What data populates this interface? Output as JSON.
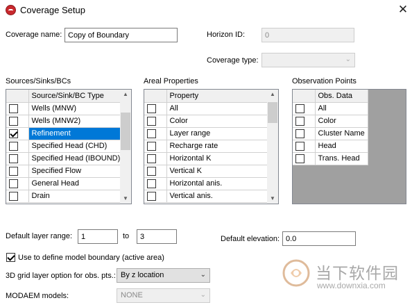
{
  "window": {
    "title": "Coverage Setup",
    "close": "✕"
  },
  "coverage_name": {
    "label": "Coverage name:",
    "value": "Copy of Boundary"
  },
  "horizon_id": {
    "label": "Horizon ID:",
    "value": "0"
  },
  "coverage_type": {
    "label": "Coverage type:",
    "value": ""
  },
  "sources": {
    "label": "Sources/Sinks/BCs",
    "header": "Source/Sink/BC Type",
    "rows": [
      {
        "label": "Wells (MNW)",
        "checked": false,
        "selected": false
      },
      {
        "label": "Wells (MNW2)",
        "checked": false,
        "selected": false
      },
      {
        "label": "Refinement",
        "checked": true,
        "selected": true
      },
      {
        "label": "Specified Head (CHD)",
        "checked": false,
        "selected": false
      },
      {
        "label": "Specified Head (IBOUND)",
        "checked": false,
        "selected": false
      },
      {
        "label": "Specified Flow",
        "checked": false,
        "selected": false
      },
      {
        "label": "General Head",
        "checked": false,
        "selected": false
      },
      {
        "label": "Drain",
        "checked": false,
        "selected": false
      }
    ]
  },
  "areal": {
    "label": "Areal Properties",
    "header": "Property",
    "rows": [
      {
        "label": "All",
        "checked": false
      },
      {
        "label": "Color",
        "checked": false
      },
      {
        "label": "Layer range",
        "checked": false
      },
      {
        "label": "Recharge rate",
        "checked": false
      },
      {
        "label": "Horizontal K",
        "checked": false
      },
      {
        "label": "Vertical K",
        "checked": false
      },
      {
        "label": "Horizontal anis.",
        "checked": false
      },
      {
        "label": "Vertical anis.",
        "checked": false
      }
    ]
  },
  "obs": {
    "label": "Observation Points",
    "header": "Obs. Data",
    "rows": [
      {
        "label": "All",
        "checked": false
      },
      {
        "label": "Color",
        "checked": false
      },
      {
        "label": "Cluster Name",
        "checked": false
      },
      {
        "label": "Head",
        "checked": false
      },
      {
        "label": "Trans. Head",
        "checked": false
      }
    ]
  },
  "layer_range": {
    "label": "Default layer range:",
    "from": "1",
    "to_label": "to",
    "to": "3"
  },
  "default_elevation": {
    "label": "Default elevation:",
    "value": "0.0"
  },
  "model_boundary": {
    "label": "Use to define model boundary (active area)",
    "checked": true
  },
  "grid_layer_option": {
    "label": "3D grid layer option for obs. pts.:",
    "value": "By z location"
  },
  "modaem": {
    "label": "MODAEM models:",
    "value": "NONE"
  },
  "watermark": {
    "text": "当下软件园",
    "url": "www.downxia.com"
  },
  "colors": {
    "selection": "#0078d7",
    "obs_background": "#a0a0a0",
    "app_icon": "#c8282d"
  }
}
